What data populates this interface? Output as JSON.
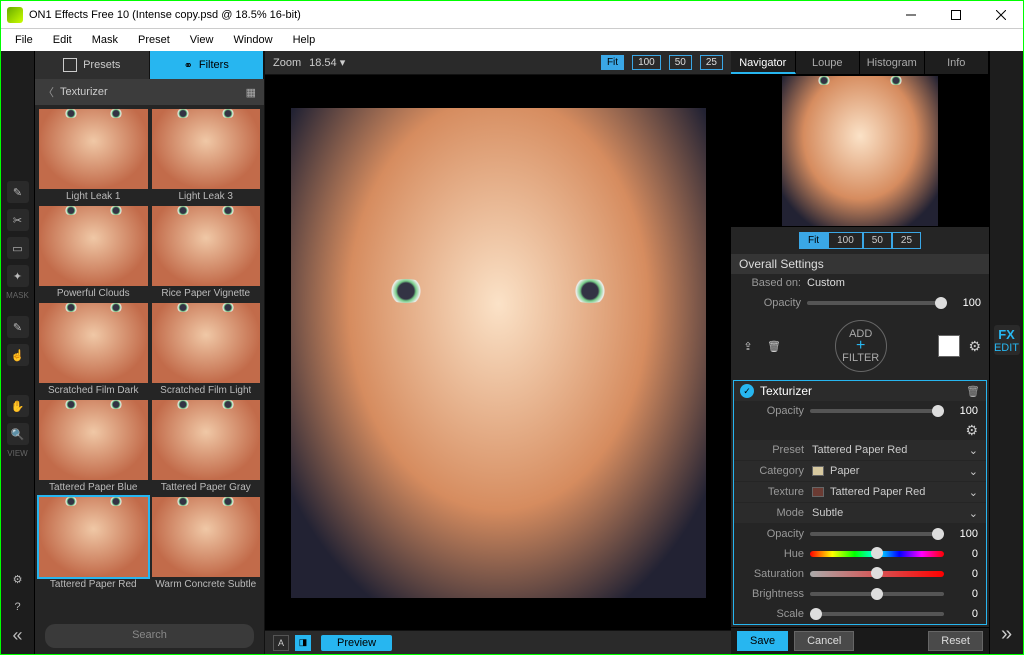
{
  "window": {
    "title": "ON1 Effects Free 10 (Intense copy.psd @ 18.5% 16-bit)"
  },
  "menubar": {
    "items": [
      "File",
      "Edit",
      "Mask",
      "Preset",
      "View",
      "Window",
      "Help"
    ]
  },
  "left_tabs": {
    "presets": "Presets",
    "filters": "Filters",
    "active": "filters"
  },
  "browser": {
    "category": "Texturizer",
    "thumbs": [
      "Light Leak 1",
      "Light Leak 3",
      "Powerful Clouds",
      "Rice Paper Vignette",
      "Scratched Film Dark",
      "Scratched Film Light",
      "Tattered Paper Blue",
      "Tattered Paper Gray",
      "Tattered Paper Red",
      "Warm Concrete Subtle"
    ],
    "selected": "Tattered Paper Red",
    "search": "Search"
  },
  "canvas_toolbar": {
    "zoom_label": "Zoom",
    "zoom_value": "18.54",
    "zoom_presets": [
      "Fit",
      "100",
      "50",
      "25"
    ]
  },
  "preview_label": "Preview",
  "nav_tabs": {
    "items": [
      "Navigator",
      "Loupe",
      "Histogram",
      "Info"
    ],
    "active": "Navigator"
  },
  "nav_zoom": [
    "Fit",
    "100",
    "50",
    "25"
  ],
  "overall": {
    "header": "Overall Settings",
    "basedon_label": "Based on:",
    "basedon_value": "Custom",
    "opacity_label": "Opacity",
    "opacity_value": "100",
    "add_top": "ADD",
    "add_bottom": "FILTER"
  },
  "filter": {
    "name": "Texturizer",
    "opacity_label": "Opacity",
    "opacity_value": "100",
    "preset_label": "Preset",
    "preset_value": "Tattered Paper Red",
    "category_label": "Category",
    "category_value": "Paper",
    "texture_label": "Texture",
    "texture_value": "Tattered Paper Red",
    "mode_label": "Mode",
    "mode_value": "Subtle",
    "opacity2_label": "Opacity",
    "opacity2_value": "100",
    "hue_label": "Hue",
    "hue_value": "0",
    "sat_label": "Saturation",
    "sat_value": "0",
    "bri_label": "Brightness",
    "bri_value": "0",
    "scale_label": "Scale",
    "scale_value": "0"
  },
  "footer": {
    "save": "Save",
    "cancel": "Cancel",
    "reset": "Reset"
  },
  "ltoolbar_label_mask": "MASK",
  "ltoolbar_label_view": "VIEW",
  "edit_label": "EDIT",
  "fx_label": "FX"
}
